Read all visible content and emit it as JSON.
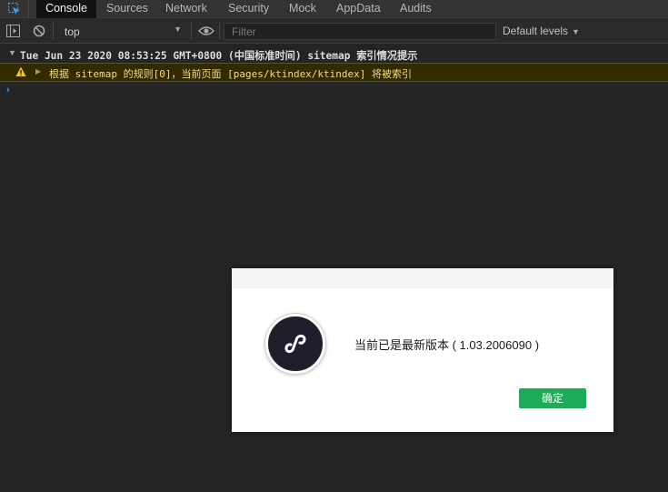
{
  "tabs": [
    {
      "label": "Console",
      "active": true
    },
    {
      "label": "Sources",
      "active": false
    },
    {
      "label": "Network",
      "active": false
    },
    {
      "label": "Security",
      "active": false
    },
    {
      "label": "Mock",
      "active": false
    },
    {
      "label": "AppData",
      "active": false
    },
    {
      "label": "Audits",
      "active": false
    }
  ],
  "toolbar": {
    "context": "top",
    "filter_placeholder": "Filter",
    "levels": "Default levels"
  },
  "console": {
    "group_header": "Tue Jun 23 2020 08:53:25 GMT+0800 (中国标准时间) sitemap 索引情况提示",
    "warning": "根据 sitemap 的规则[0]，当前页面 [pages/ktindex/ktindex] 将被索引"
  },
  "dialog": {
    "message": "当前已是最新版本 ( 1.03.2006090 )",
    "ok_label": "确定"
  },
  "colors": {
    "accent_blue": "#3b9cf0",
    "warning_text": "#f5d986",
    "warning_bg": "#332b00",
    "ok_green": "#1aad56"
  }
}
